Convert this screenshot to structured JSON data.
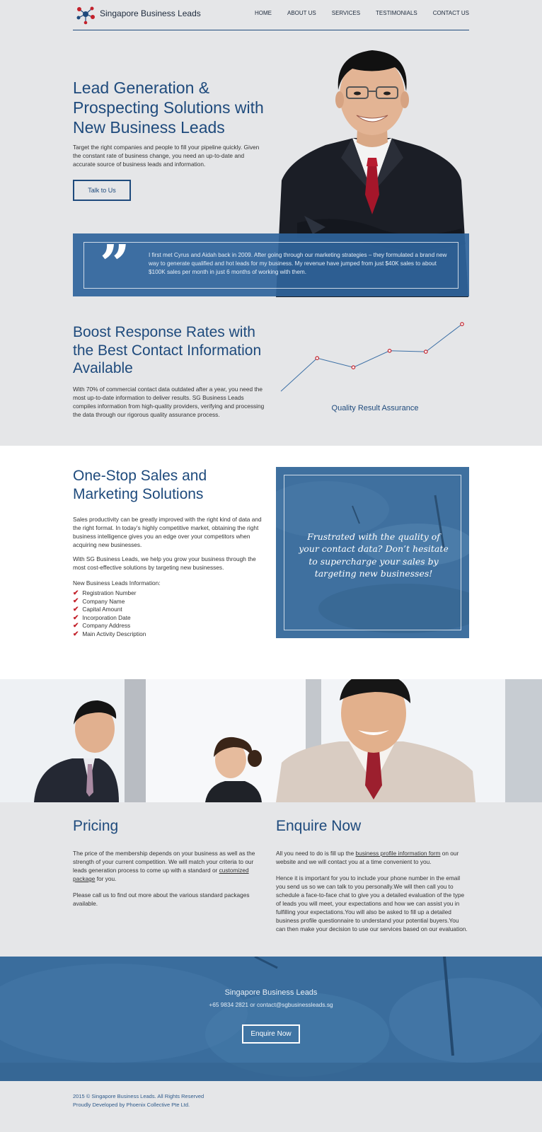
{
  "header": {
    "brand": "Singapore Business Leads",
    "nav": [
      "HOME",
      "ABOUT US",
      "SERVICES",
      "TESTIMONIALS",
      "CONTACT US"
    ]
  },
  "hero": {
    "title": "Lead Generation & Prospecting Solutions with New Business Leads",
    "text": "Target the right companies and people to fill your pipeline quickly. Given the constant rate of business change, you need an up-to-date and accurate source of business leads and information.",
    "button": "Talk to Us"
  },
  "quote": {
    "mark": "”",
    "text": "I first met Cyrus and Aidah back in 2009. After going through our marketing strategies – they formulated a brand new way to generate qualified and hot leads for my business. My revenue have jumped from just $40K sales to about $100K sales per month in just 6 months of working with them."
  },
  "boost": {
    "title": "Boost Response Rates with the Best Contact Information Available",
    "text": "With 70% of commercial contact data outdated after a year, you need the most up-to-date information to deliver results. SG Business Leads compiles information from high-quality providers, verifying and processing the data through our rigorous quality assurance process.",
    "chart_caption": "Quality Result Assurance"
  },
  "chart_data": {
    "type": "line",
    "title": "Quality Result Assurance",
    "x": [
      0,
      1,
      2,
      3,
      4,
      5
    ],
    "values": [
      0,
      3.6,
      2.6,
      4.4,
      4.3,
      7.3
    ],
    "ylim": [
      0,
      8
    ],
    "markers_from_index": 1,
    "color": "#3b6fa5",
    "marker_color": "#c3212b",
    "grid": false
  },
  "onestop": {
    "title": "One-Stop Sales and Marketing Solutions",
    "p1": "Sales productivity can be greatly improved with the right kind of data and the right format. In today’s highly competitive market, obtaining the right business intelligence gives you an edge over your competitors when acquiring new businesses.",
    "p2": "With SG Business Leads, we help you grow your business through the most cost-effective solutions by targeting new businesses.",
    "list_label": "New Business Leads Information:",
    "items": [
      "Registration Number",
      "Company Name",
      "Capital Amount",
      "Incorporation Date",
      "Company Address",
      "Main Activity Description"
    ],
    "check_icon": "check-icon"
  },
  "promo": {
    "text": "Frustrated with the quality of your contact data? Don’t hesitate to supercharge your sales by targeting new businesses!"
  },
  "pricing": {
    "title": "Pricing",
    "p1_before": "The price of the membership depends on your business as well as the strength of your current competition. We will match your criteria to our leads generation process to come up with a standard or",
    "p1_link": "customized package",
    "p1_after": "for you.",
    "p2": "Please call us to find out more about the various standard packages available."
  },
  "enquire": {
    "title": "Enquire Now",
    "p1_before": "All you need to do is fill up the",
    "p1_link": "business profile information form",
    "p1_after": "on our website and we will contact you at a time convenient to you.",
    "p2": "Hence it is important for you to include your phone number in the email you send us so we can talk to you personally.We will then call you to schedule a face-to-face chat to give you a detailed evaluation of the type of leads you will meet, your expectations and how we can assist you in fulfilling your expectations.You will also be asked to fill up a detailed business profile questionnaire to understand your potential buyers.You can then make your decision to use our services based on our evaluation."
  },
  "cta": {
    "name": "Singapore Business Leads",
    "contact": "+65 9834 2821 or contact@sgbusinessleads.sg",
    "button": "Enquire Now"
  },
  "footer": {
    "copyright": "2015 © Singapore Business Leads. All Rights Reserved",
    "developer": "Proudly Developed by Phoenix Collective Pte Ltd."
  },
  "colors": {
    "brand_blue": "#1e4a7c",
    "panel_blue": "#3f709f",
    "accent_red": "#c3212b",
    "background": "#e5e6e8"
  }
}
